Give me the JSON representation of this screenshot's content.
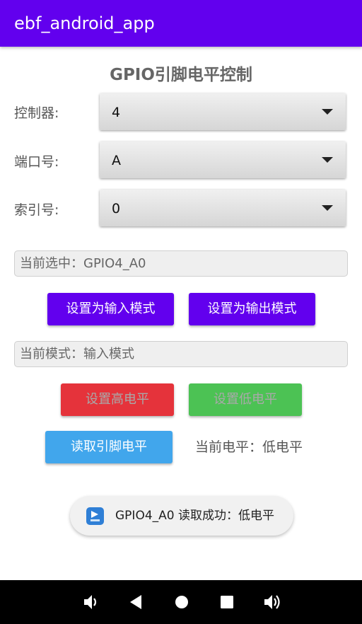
{
  "app_bar": {
    "title": "ebf_android_app"
  },
  "page": {
    "title": "GPIO引脚电平控制"
  },
  "controller": {
    "label": "控制器:",
    "value": "4"
  },
  "port": {
    "label": "端口号:",
    "value": "A"
  },
  "index": {
    "label": "索引号:",
    "value": "0"
  },
  "selection": {
    "text": "当前选中：GPIO4_A0"
  },
  "mode_buttons": {
    "input": "设置为输入模式",
    "output": "设置为输出模式"
  },
  "mode": {
    "text": "当前模式：输入模式"
  },
  "level_buttons": {
    "high": "设置高电平",
    "low": "设置低电平",
    "read": "读取引脚电平"
  },
  "level": {
    "text": "当前电平：低电平"
  },
  "toast": {
    "message": "GPIO4_A0 读取成功：低电平",
    "icon": "app-icon"
  },
  "nav": {
    "icons": [
      "volume-down-icon",
      "back-icon",
      "home-icon",
      "recents-icon",
      "volume-up-icon"
    ]
  },
  "colors": {
    "primary": "#6200ee",
    "red": "#e5333b",
    "green": "#4cc254",
    "blue": "#41a6ec"
  }
}
